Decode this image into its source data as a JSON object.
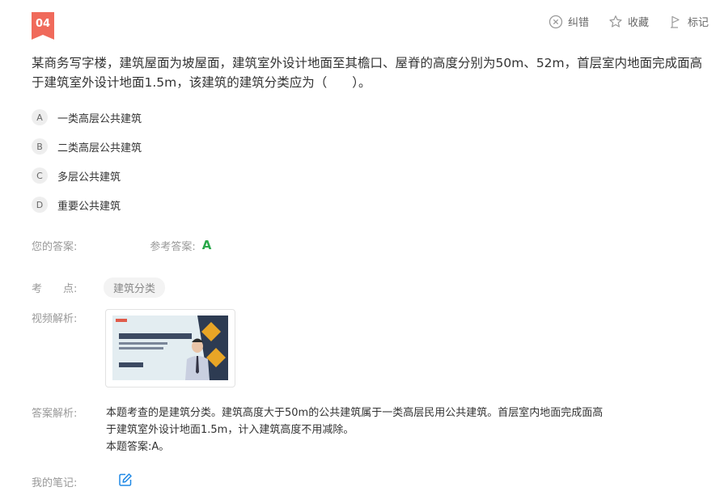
{
  "question": {
    "number": "04",
    "text": "某商务写字楼，建筑屋面为坡屋面，建筑室外设计地面至其檐口、屋脊的高度分别为50m、52m，首层室内地面完成面高于建筑室外设计地面1.5m，该建筑的建筑分类应为（　　）。"
  },
  "toolbar": {
    "correct_label": "纠错",
    "collect_label": "收藏",
    "mark_label": "标记"
  },
  "options": [
    {
      "letter": "A",
      "text": "一类高层公共建筑"
    },
    {
      "letter": "B",
      "text": "二类高层公共建筑"
    },
    {
      "letter": "C",
      "text": "多层公共建筑"
    },
    {
      "letter": "D",
      "text": "重要公共建筑"
    }
  ],
  "answer": {
    "yours_label": "您的答案:",
    "yours_value": "",
    "ref_label": "参考答案:",
    "ref_value": "A"
  },
  "knowledge": {
    "label_a": "考",
    "label_b": "点:",
    "tag": "建筑分类"
  },
  "video": {
    "label": "视频解析:"
  },
  "analysis": {
    "label": "答案解析:",
    "line1": "本题考查的是建筑分类。建筑高度大于50m的公共建筑属于一类高层民用公共建筑。首层室内地面完成面高",
    "line2": "于建筑室外设计地面1.5m，计入建筑高度不用减除。",
    "line3": "本题答案:A。"
  },
  "notes": {
    "label": "我的笔记:"
  },
  "colors": {
    "badge": "#f06a5b",
    "answer_green": "#2aa84a",
    "edit_blue": "#1e88e5"
  }
}
